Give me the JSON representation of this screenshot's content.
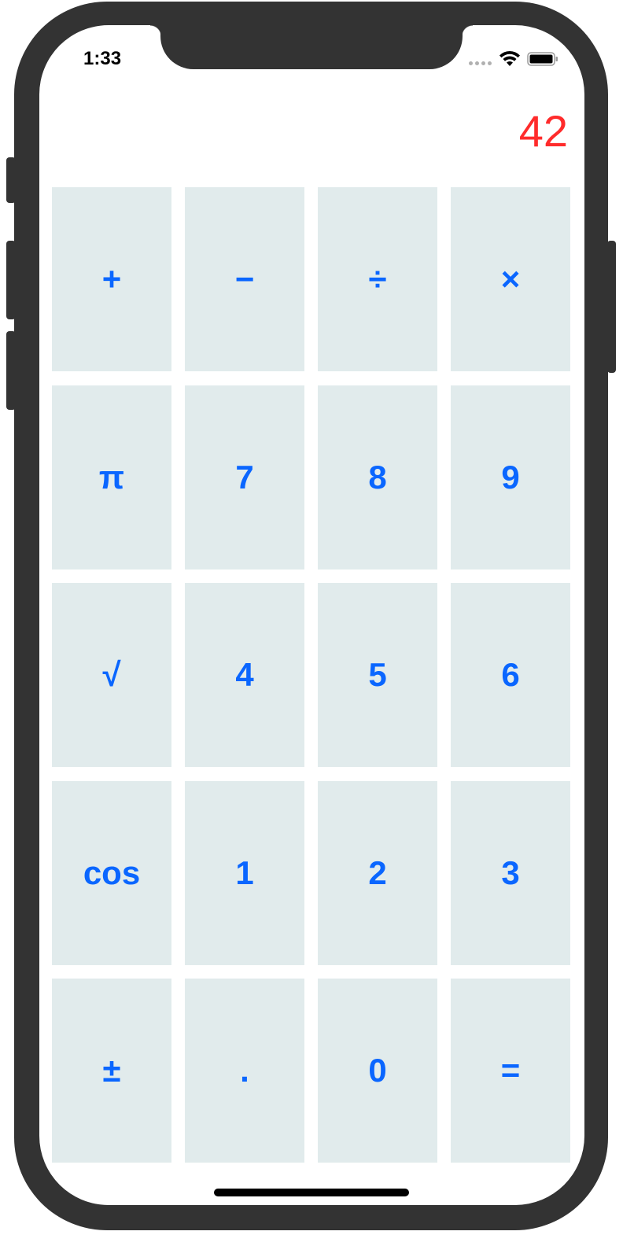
{
  "status_bar": {
    "time": "1:33",
    "icons": [
      "signal-icon",
      "wifi-icon",
      "battery-icon"
    ]
  },
  "display": {
    "value": "42",
    "color": "#ff2b2b"
  },
  "colors": {
    "key_background": "#e1ebec",
    "key_text": "#0a66ff",
    "frame": "#333333"
  },
  "keys": [
    {
      "id": "add",
      "label": "+"
    },
    {
      "id": "subtract",
      "label": "−"
    },
    {
      "id": "divide",
      "label": "÷"
    },
    {
      "id": "multiply",
      "label": "×"
    },
    {
      "id": "pi",
      "label": "π"
    },
    {
      "id": "7",
      "label": "7"
    },
    {
      "id": "8",
      "label": "8"
    },
    {
      "id": "9",
      "label": "9"
    },
    {
      "id": "sqrt",
      "label": "√"
    },
    {
      "id": "4",
      "label": "4"
    },
    {
      "id": "5",
      "label": "5"
    },
    {
      "id": "6",
      "label": "6"
    },
    {
      "id": "cos",
      "label": "cos"
    },
    {
      "id": "1",
      "label": "1"
    },
    {
      "id": "2",
      "label": "2"
    },
    {
      "id": "3",
      "label": "3"
    },
    {
      "id": "plus-minus",
      "label": "±"
    },
    {
      "id": "decimal",
      "label": "."
    },
    {
      "id": "0",
      "label": "0"
    },
    {
      "id": "equals",
      "label": "="
    }
  ]
}
